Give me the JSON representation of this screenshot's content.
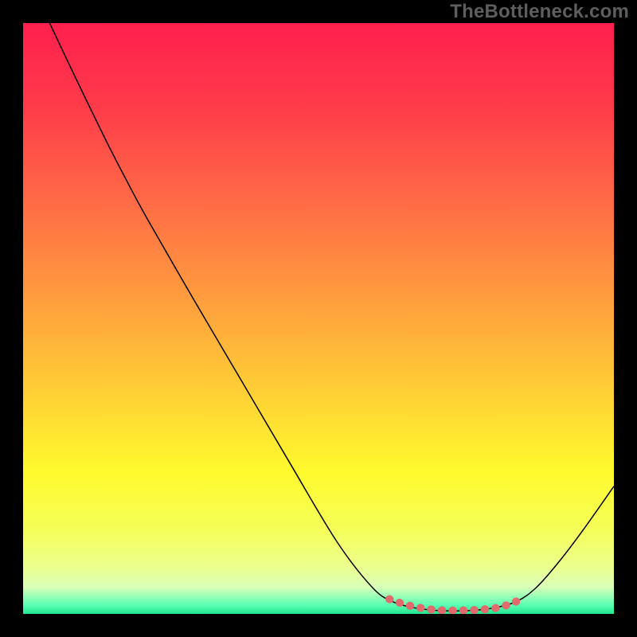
{
  "watermark": "TheBottleneck.com",
  "chart_data": {
    "type": "line",
    "title": "",
    "xlabel": "",
    "ylabel": "",
    "xlim": [
      0,
      100
    ],
    "ylim": [
      0,
      100
    ],
    "grid": false,
    "legend": false,
    "gradient_stops": [
      {
        "offset": 0,
        "color": "#ff1f4e"
      },
      {
        "offset": 0.14,
        "color": "#ff3b4a"
      },
      {
        "offset": 0.3,
        "color": "#ff6a46"
      },
      {
        "offset": 0.46,
        "color": "#ff9b3e"
      },
      {
        "offset": 0.62,
        "color": "#ffce35"
      },
      {
        "offset": 0.76,
        "color": "#fffa2d"
      },
      {
        "offset": 0.86,
        "color": "#f5ff5a"
      },
      {
        "offset": 0.92,
        "color": "#ecff8e"
      },
      {
        "offset": 0.955,
        "color": "#d9ffb9"
      },
      {
        "offset": 0.985,
        "color": "#5bffb3"
      },
      {
        "offset": 1,
        "color": "#20e48e"
      }
    ],
    "series": [
      {
        "name": "bottleneck-curve",
        "type": "line",
        "stroke": "#000000",
        "stroke_width": 1.5,
        "data": [
          {
            "x": 4.5,
            "y": 100.0
          },
          {
            "x": 9.0,
            "y": 90.5
          },
          {
            "x": 14.0,
            "y": 80.2
          },
          {
            "x": 17.5,
            "y": 73.4
          },
          {
            "x": 21.0,
            "y": 66.9
          },
          {
            "x": 29.0,
            "y": 53.0
          },
          {
            "x": 37.0,
            "y": 39.4
          },
          {
            "x": 45.0,
            "y": 25.8
          },
          {
            "x": 53.0,
            "y": 12.4
          },
          {
            "x": 59.0,
            "y": 4.6
          },
          {
            "x": 62.5,
            "y": 2.1
          },
          {
            "x": 67.0,
            "y": 0.9
          },
          {
            "x": 73.0,
            "y": 0.5
          },
          {
            "x": 79.0,
            "y": 0.9
          },
          {
            "x": 83.5,
            "y": 2.1
          },
          {
            "x": 87.0,
            "y": 4.6
          },
          {
            "x": 91.0,
            "y": 9.2
          },
          {
            "x": 95.0,
            "y": 14.5
          },
          {
            "x": 100.0,
            "y": 21.6
          }
        ]
      },
      {
        "name": "optimal-band",
        "type": "line",
        "stroke": "#e26a6c",
        "stroke_width": 10,
        "data": [
          {
            "x": 62.0,
            "y": 2.5
          },
          {
            "x": 65.0,
            "y": 1.5
          },
          {
            "x": 68.0,
            "y": 0.9
          },
          {
            "x": 71.0,
            "y": 0.6
          },
          {
            "x": 74.0,
            "y": 0.6
          },
          {
            "x": 77.0,
            "y": 0.7
          },
          {
            "x": 80.0,
            "y": 1.0
          },
          {
            "x": 82.5,
            "y": 1.7
          },
          {
            "x": 84.5,
            "y": 2.6
          }
        ]
      }
    ]
  }
}
